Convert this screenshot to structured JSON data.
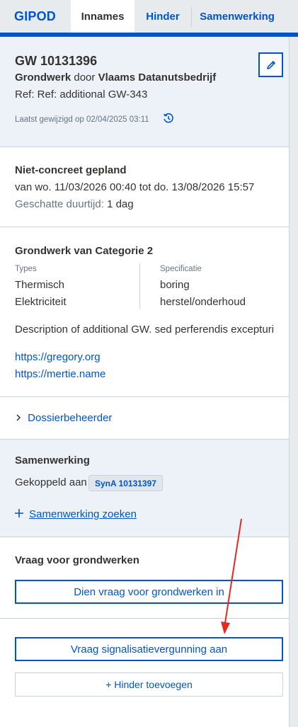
{
  "nav": {
    "brand": "GIPOD",
    "tabs": [
      {
        "label": "Innames"
      },
      {
        "label": "Hinder"
      },
      {
        "label": "Samenwerking"
      }
    ]
  },
  "header": {
    "id": "GW 10131396",
    "type": "Grondwerk",
    "by": "door",
    "owner": "Vlaams Datanutsbedrijf",
    "ref": "Ref: Ref: additional GW-343",
    "last_modified": "Laatst gewijzigd op 02/04/2025 03:11"
  },
  "planning": {
    "status": "Niet-concreet gepland",
    "period": "van wo. 11/03/2026 00:40 tot do. 13/08/2026 15:57",
    "duration_label": "Geschatte duurtijd:",
    "duration_value": "1 dag"
  },
  "category": {
    "title": "Grondwerk van Categorie 2",
    "types_label": "Types",
    "spec_label": "Specificatie",
    "types": [
      "Thermisch",
      "Elektriciteit"
    ],
    "specs": [
      "boring",
      "herstel/onderhoud"
    ],
    "description": "Description of additional GW. sed perferendis excepturi",
    "links": [
      "https://gregory.org",
      "https://mertie.name"
    ]
  },
  "dossier": {
    "label": "Dossierbeheerder"
  },
  "collaboration": {
    "title": "Samenwerking",
    "linked_label": "Gekoppeld aan",
    "linked_badge": "SynA 10131397",
    "search_link": "Samenwerking zoeken"
  },
  "question": {
    "title": "Vraag voor grondwerken",
    "submit_button": "Dien vraag voor grondwerken in"
  },
  "actions": {
    "permit_button": "Vraag signalisatievergunning aan",
    "add_hinder_button": "+ Hinder toevoegen"
  },
  "colors": {
    "primary": "#0055cc",
    "text": "#333332",
    "muted": "#687483",
    "panel_light": "#edf1f8",
    "annotation_arrow": "#e8281e"
  }
}
